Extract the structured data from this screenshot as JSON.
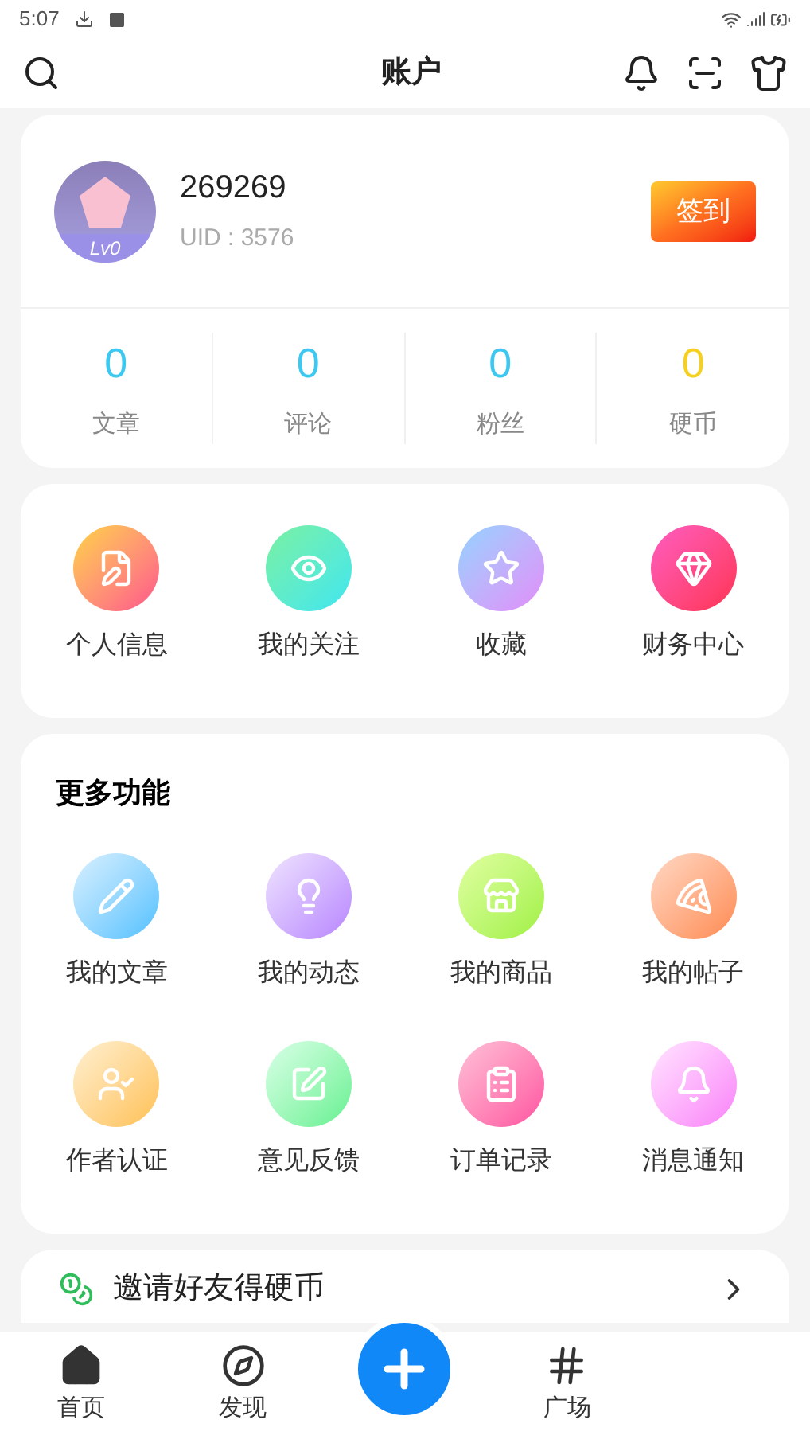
{
  "status_bar": {
    "time": "5:07"
  },
  "header": {
    "title": "账户"
  },
  "profile": {
    "name": "269269",
    "uid": "UID : 3576",
    "level_badge": "Lv0",
    "checkin_button": "签到"
  },
  "stats": [
    {
      "value": "0",
      "label": "文章",
      "color": "#3cc8f0"
    },
    {
      "value": "0",
      "label": "评论",
      "color": "#3cc8f0"
    },
    {
      "value": "0",
      "label": "粉丝",
      "color": "#3cc8f0"
    },
    {
      "value": "0",
      "label": "硬币",
      "color": "#f5d020"
    }
  ],
  "quick_actions": [
    {
      "label": "个人信息"
    },
    {
      "label": "我的关注"
    },
    {
      "label": "收藏"
    },
    {
      "label": "财务中心"
    }
  ],
  "more_features": {
    "title": "更多功能",
    "items": [
      {
        "label": "我的文章"
      },
      {
        "label": "我的动态"
      },
      {
        "label": "我的商品"
      },
      {
        "label": "我的帖子"
      },
      {
        "label": "作者认证"
      },
      {
        "label": "意见反馈"
      },
      {
        "label": "订单记录"
      },
      {
        "label": "消息通知"
      }
    ]
  },
  "invite_row": {
    "label": "邀请好友得硬币"
  },
  "bottom_nav": [
    {
      "label": "首页",
      "selected": false
    },
    {
      "label": "发现",
      "selected": false
    },
    {
      "label": "广场",
      "selected": false
    }
  ]
}
